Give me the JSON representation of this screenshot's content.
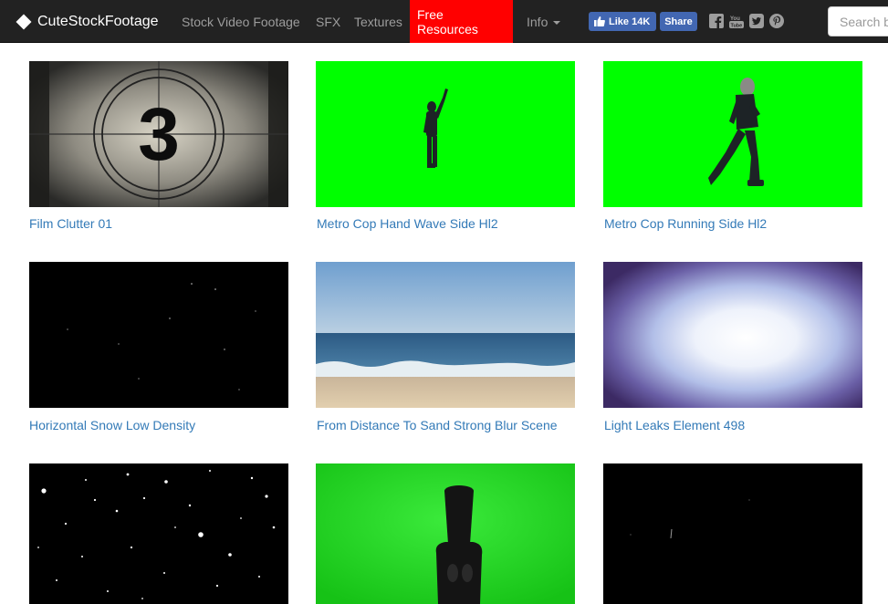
{
  "navbar": {
    "brand": "CuteStockFootage",
    "items": [
      {
        "label": "Stock Video Footage"
      },
      {
        "label": "SFX"
      },
      {
        "label": "Textures"
      },
      {
        "label": "Free Resources"
      },
      {
        "label": "Info"
      }
    ],
    "facebook": {
      "like_label": "Like",
      "like_count": "14K",
      "share_label": "Share"
    },
    "social_icons": [
      "facebook-icon",
      "youtube-icon",
      "twitter-icon",
      "pinterest-icon"
    ],
    "search": {
      "placeholder": "Search by"
    },
    "colors": {
      "bar": "#222222",
      "active": "#ff0000",
      "facebook": "#4267b2",
      "link": "#337ab7",
      "greenscreen": "#00ff00"
    }
  },
  "grid": {
    "items": [
      {
        "title": "Film Clutter 01",
        "countdown": "3"
      },
      {
        "title": "Metro Cop Hand Wave Side Hl2"
      },
      {
        "title": "Metro Cop Running Side Hl2"
      },
      {
        "title": "Horizontal Snow Low Density"
      },
      {
        "title": "From Distance To Sand Strong Blur Scene"
      },
      {
        "title": "Light Leaks Element 498"
      },
      {
        "title": ""
      },
      {
        "title": ""
      },
      {
        "title": ""
      }
    ]
  }
}
